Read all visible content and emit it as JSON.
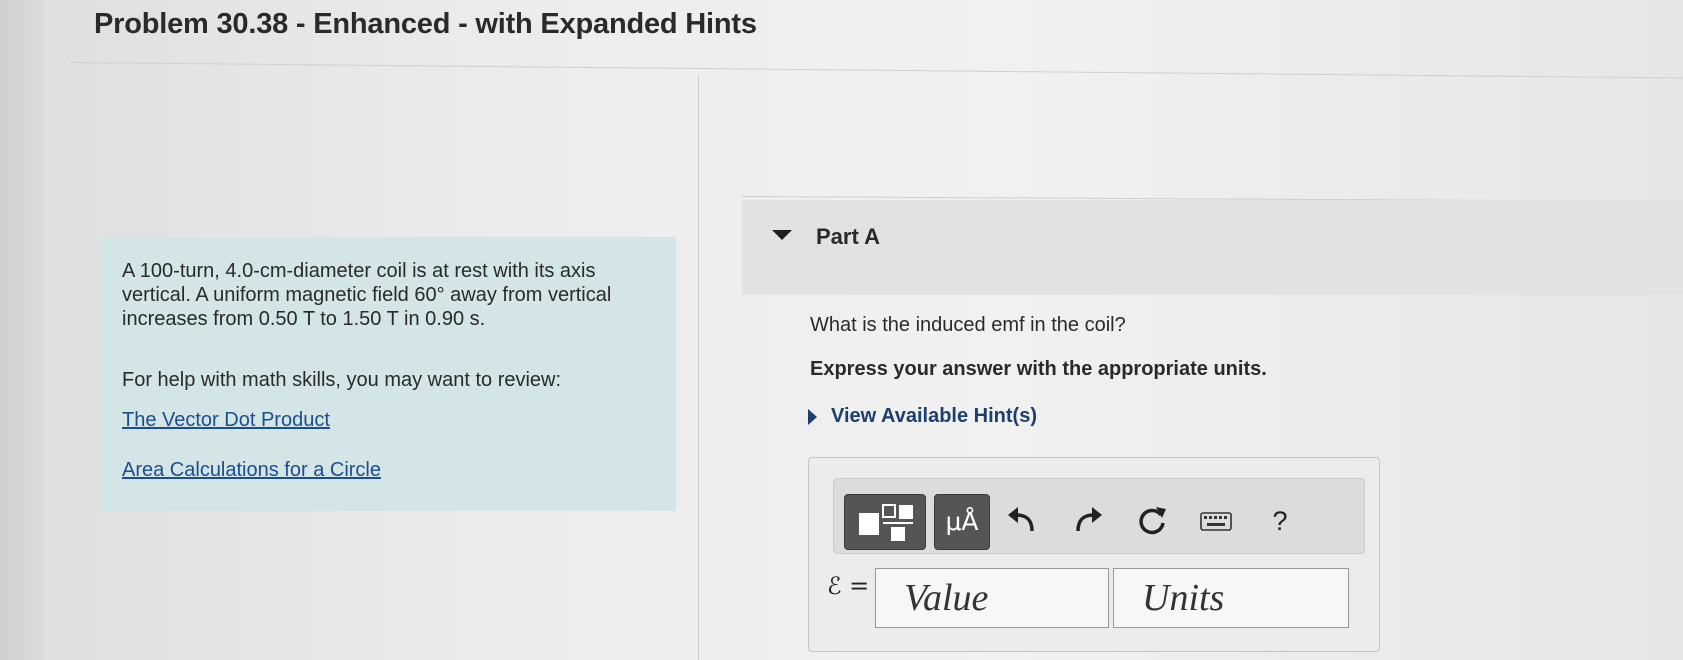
{
  "page": {
    "title": "Problem 30.38 - Enhanced - with Expanded Hints"
  },
  "problem": {
    "statement_line1": "A 100-turn, 4.0-cm-diameter coil is at rest with its axis vertical. A uniform magnetic field 60° away from vertical increases from 0.50 T to 1.50 T in 0.90 s.",
    "help_text": "For help with math skills, you may want to review:",
    "links": [
      {
        "label": "The Vector Dot Product"
      },
      {
        "label": "Area Calculations for a Circle"
      }
    ]
  },
  "part": {
    "label": "Part A",
    "question": "What is the induced emf in the coil?",
    "instruction": "Express your answer with the appropriate units.",
    "hint_label": "View Available Hint(s)"
  },
  "toolbar": {
    "units_label": "μÅ",
    "help_label": "?",
    "icons": [
      "template-icon",
      "units-icon",
      "undo-icon",
      "redo-icon",
      "reset-icon",
      "keyboard-icon",
      "help-icon"
    ]
  },
  "answer": {
    "variable_label": "ℰ =",
    "value_placeholder": "Value",
    "units_placeholder": "Units"
  },
  "colors": {
    "problem_box": "#d3e5e6",
    "link": "#1d4e8c",
    "hint": "#1d3f6e",
    "toolbar_dark_button": "#555555"
  }
}
